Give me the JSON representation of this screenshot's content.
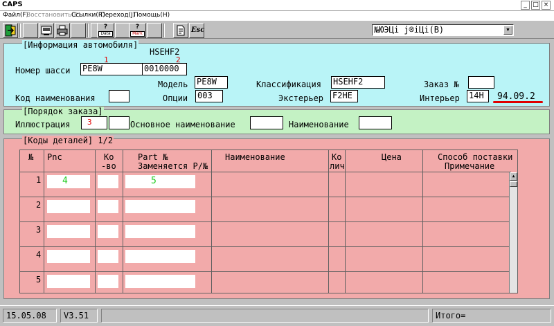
{
  "window": {
    "title": "CAPS"
  },
  "window_controls": {
    "minimize": "_",
    "maximize": "□",
    "close": "×"
  },
  "menu": {
    "items": [
      {
        "label": "Файл(F)",
        "enabled": true
      },
      {
        "label": "Восстановить(E)",
        "enabled": false
      },
      {
        "label": "Ссылки(R)",
        "enabled": true
      },
      {
        "label": "Переход(J)",
        "enabled": true
      },
      {
        "label": "Помощь(H)",
        "enabled": true
      }
    ]
  },
  "toolbar": {
    "buttons": [
      {
        "name": "exit-icon"
      },
      {
        "name": "book-icon"
      },
      {
        "name": "blank-icon"
      },
      {
        "name": "print-icon"
      },
      {
        "name": "blank-icon"
      },
      {
        "name": "data-icon",
        "label": "Data"
      },
      {
        "name": "blank-icon"
      },
      {
        "name": "mark-icon",
        "label": "Mark"
      },
      {
        "name": "blank-icon"
      },
      {
        "name": "document-icon"
      },
      {
        "name": "escape-icon",
        "label": "Esc"
      }
    ],
    "question_mark": "?",
    "language_select": "№ЮЭЦі ј®іЦі(B)",
    "language_arrow": "▼"
  },
  "car_info": {
    "legend": "[Информация автомобиля]",
    "top_code": "HSEHF2",
    "chassis_label": "Номер шасси",
    "chassis_part1": "PE8W",
    "chassis_part2": "0010000",
    "marker1": "1",
    "marker2": "2",
    "model_label": "Модель",
    "model_value": "PE8W",
    "classification_label": "Классификация",
    "classification_value": "HSEHF2",
    "order_label": "Заказ №",
    "order_value": "",
    "name_code_label": "Код наименования",
    "name_code_value": "",
    "options_label": "Опции",
    "options_value": "003",
    "exterior_label": "Экстерьер",
    "exterior_value": "F2HE",
    "interior_label": "Интерьер",
    "interior_value": "14H",
    "date_value": "94.09.2"
  },
  "order": {
    "legend": "[Порядок заказа]",
    "illustration_label": "Иллюстрация",
    "illustration_marker": "3",
    "main_name_label": "Основное наименование",
    "name_label": "Наименование"
  },
  "parts": {
    "legend": "[Коды деталей] 1/2",
    "columns": {
      "num": "№",
      "pnc": "Pnc",
      "qty_1": "Ко",
      "qty_2": "-во",
      "part_1": "Part №",
      "part_2": "Заменяется Р/№",
      "name": "Наименование",
      "qty_per_1": "Ко",
      "qty_per_2": "лич",
      "price": "Цена",
      "supply_1": "Способ поставки",
      "supply_2": "Примечание"
    },
    "rows": [
      "1",
      "2",
      "3",
      "4",
      "5"
    ],
    "marker4": "4",
    "marker5": "5",
    "scroll_up": "▲"
  },
  "status": {
    "date": "15.05.08",
    "version": "V3.51",
    "message": "",
    "total_label": "Итого="
  }
}
